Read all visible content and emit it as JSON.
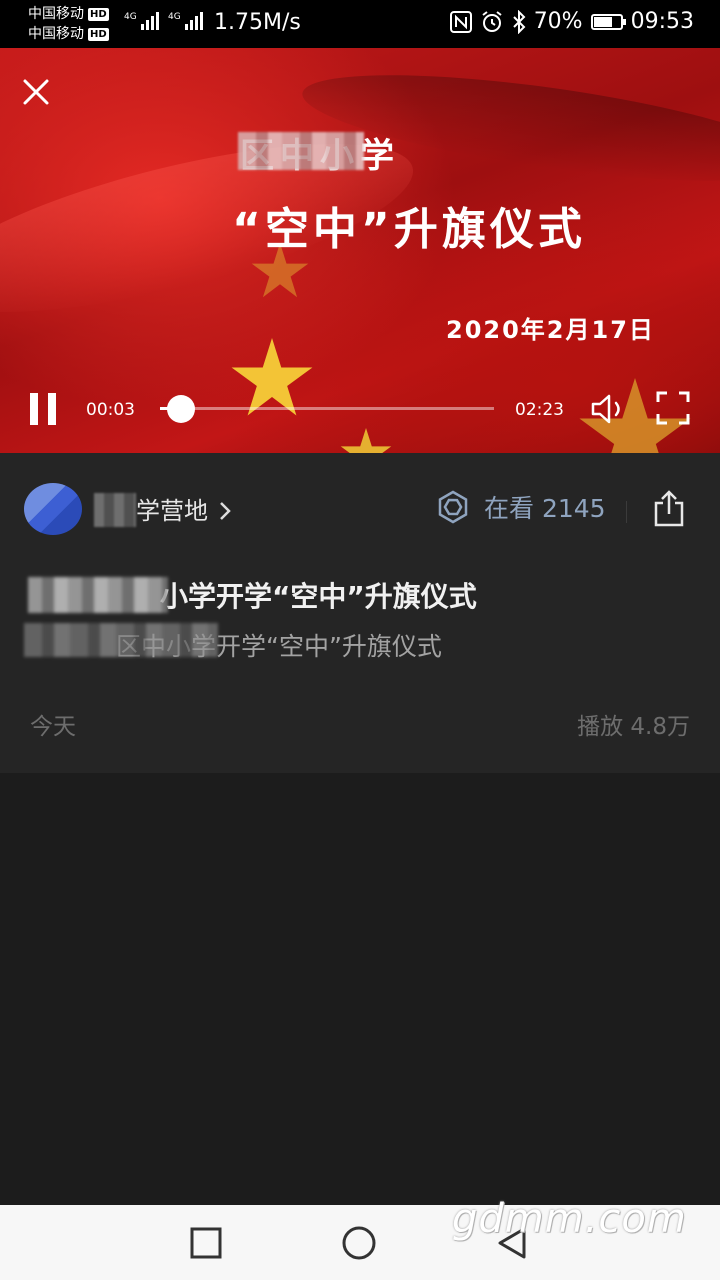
{
  "status_bar": {
    "carrier_1": "中国移动",
    "carrier_2": "中国移动",
    "hd_badge": "HD",
    "network_label": "4G",
    "speed": "1.75M/s",
    "battery_percent": "70%",
    "battery_level": 0.7,
    "time": "09:53",
    "icons": [
      "nfc-icon",
      "alarm-icon",
      "bluetooth-icon",
      "battery-icon"
    ]
  },
  "video": {
    "title_line1": "区中小学",
    "title_line2": "“空中”升旗仪式",
    "date_text": "2020年2月17日",
    "current_time": "00:03",
    "total_time": "02:23",
    "progress": 0.02,
    "played_fraction": 0.06
  },
  "info": {
    "account_name": "学营地",
    "watching_label": "在看 2145",
    "title": "小学开学“空中”升旗仪式",
    "subtitle": "区中小学开学“空中”升旗仪式",
    "date": "今天",
    "plays": "播放 4.8万"
  },
  "watermark": "gdmm.com",
  "colors": {
    "panel_bg": "#252525",
    "page_bg": "#1c1c1c",
    "watching_accent": "#8fa4bf"
  }
}
